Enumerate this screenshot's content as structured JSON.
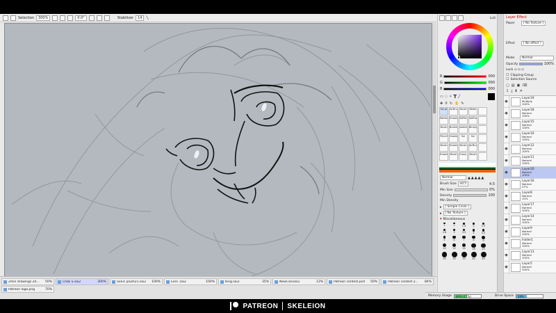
{
  "toolbar": {
    "selection_label": "Selection",
    "zoom": "300%",
    "rotation": "0.0°",
    "stabilizer_label": "Stabilizer",
    "stabilizer_value": "14"
  },
  "tabs": [
    {
      "name": "2min drawings 20...",
      "zoom": "50%"
    },
    {
      "name": "Chibi S.sai2",
      "zoom": "300%",
      "active": true
    },
    {
      "name": "Sonic plush21.sai2",
      "zoom": "100%"
    },
    {
      "name": "Ears .sai2",
      "zoom": "100%"
    },
    {
      "name": "King.sai2",
      "zoom": "35%"
    },
    {
      "name": "NewCanvas2",
      "zoom": "13%"
    },
    {
      "name": "Patreon contest.psd",
      "zoom": "50%"
    },
    {
      "name": "Patreon contest 2...",
      "zoom": "84%"
    },
    {
      "name": "Patreon logo.png",
      "zoom": "70%"
    }
  ],
  "color": {
    "hue_label": "Hue",
    "r_label": "R",
    "g_label": "G",
    "b_label": "B",
    "r_value": "000",
    "g_value": "000",
    "b_value": "000"
  },
  "tools": [
    "Sel pt",
    "AirBrush",
    "Brush",
    "Water",
    "",
    "Marker",
    "Eraser",
    "SelPen",
    "SelEra",
    "",
    "Brush",
    "Bucket",
    "sketch",
    "Binary",
    "",
    "Pencil",
    "Gradat.",
    "Sui",
    "Sui",
    "",
    "Brush",
    "Eraser",
    "Brush",
    "AirBrush",
    "",
    "Eraser",
    "Brush",
    "Cross...",
    "Brush",
    ""
  ],
  "brush": {
    "blend_mode": "Normal",
    "size_label": "Brush Size",
    "size_mult": "x0.5",
    "size_value": "4.5",
    "min_size_label": "Min Size",
    "min_size_value": "0%",
    "density_label": "Density",
    "density_value": "100",
    "min_density_label": "Min Density",
    "shape": "[ Simple Circle ]",
    "texture": "[ No Texture ]",
    "misc_label": "Miscellaneous",
    "size_presets": [
      "1",
      "1",
      "1.5",
      "2",
      "2.3",
      "2.6",
      "3",
      "3.5",
      "4",
      "4.5",
      "5",
      "6",
      "7",
      "8",
      "9",
      "10",
      "12",
      "14",
      "16",
      "20",
      "25",
      "30",
      "35",
      "40",
      "50"
    ]
  },
  "layer_panel": {
    "title": "Layer Effect",
    "paper_label": "Paper",
    "paper_value": "[ No Texture ]",
    "effect_label": "Effect",
    "effect_value": "[ No effect ]",
    "mode_label": "Mode",
    "mode_value": "Normal",
    "opacity_label": "Opacity",
    "opacity_value": "100%",
    "lock_label": "Lock",
    "clipping_label": "Clipping Group",
    "selection_source_label": "Selection Source"
  },
  "layers": [
    {
      "name": "Layer19",
      "mode": "Multiply",
      "opacity": "100%"
    },
    {
      "name": "Layer18",
      "mode": "Normal",
      "opacity": "100%"
    },
    {
      "name": "Layer15",
      "mode": "Normal",
      "opacity": "100%"
    },
    {
      "name": "Layer10",
      "mode": "Normal",
      "opacity": "100%"
    },
    {
      "name": "Layer12",
      "mode": "Normal",
      "opacity": "100%"
    },
    {
      "name": "Layer11",
      "mode": "Normal",
      "opacity": "100%"
    },
    {
      "name": "Layer20",
      "mode": "Normal",
      "opacity": "100%",
      "selected": true
    },
    {
      "name": "Layer16",
      "mode": "Normal",
      "opacity": "27%"
    },
    {
      "name": "Layer8",
      "mode": "Normal",
      "opacity": "10%"
    },
    {
      "name": "Layer17",
      "mode": "Normal",
      "opacity": "100%"
    },
    {
      "name": "Layer14",
      "mode": "Normal",
      "opacity": "100%"
    },
    {
      "name": "Layer9",
      "mode": "Normal",
      "opacity": "100%"
    },
    {
      "name": "Folder1",
      "mode": "Normal",
      "opacity": "100%"
    },
    {
      "name": "Layer13",
      "mode": "Normal",
      "opacity": "100%"
    },
    {
      "name": "Layer5",
      "mode": "Normal",
      "opacity": "100%"
    }
  ],
  "status": {
    "memory_label": "Memory Usage",
    "memory_value": "49% (17%)",
    "memory_fraction": 0.49,
    "drive_label": "Drive Space",
    "drive_value": "39%",
    "drive_fraction": 0.39
  },
  "branding": {
    "patreon": "PATREON",
    "artist": "SKELEION"
  }
}
